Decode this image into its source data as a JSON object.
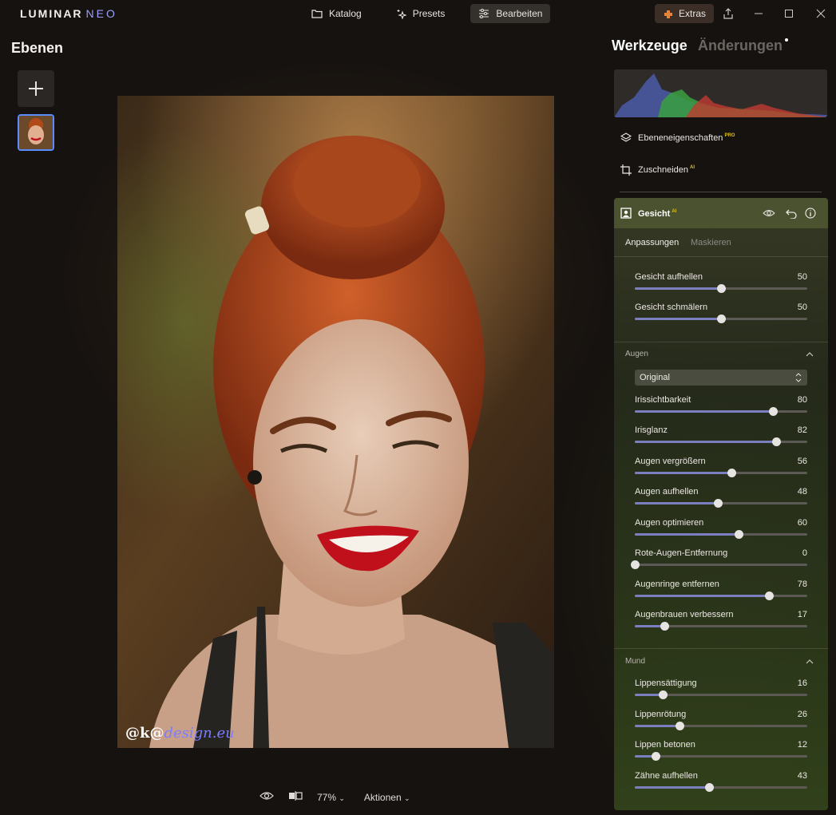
{
  "app": {
    "logo_main": "LUMINAR",
    "logo_accent": "NEO"
  },
  "topnav": [
    {
      "label": "Katalog",
      "icon": "folder-icon",
      "active": false
    },
    {
      "label": "Presets",
      "icon": "sparkle-icon",
      "active": false
    },
    {
      "label": "Bearbeiten",
      "icon": "sliders-icon",
      "active": true
    }
  ],
  "extras": {
    "label": "Extras"
  },
  "layers": {
    "title": "Ebenen"
  },
  "right_tabs": {
    "tools": "Werkzeuge",
    "history": "Änderungen"
  },
  "tools": {
    "layer_props": {
      "label": "Ebeneneigenschaften",
      "badge": "PRO"
    },
    "crop": {
      "label": "Zuschneiden",
      "badge": "AI"
    }
  },
  "face_tool": {
    "title": "Gesicht",
    "badge": "AI",
    "subtabs": [
      "Anpassungen",
      "Maskieren"
    ],
    "general": [
      {
        "label": "Gesicht aufhellen",
        "value": 50
      },
      {
        "label": "Gesicht schmälern",
        "value": 50
      }
    ],
    "eyes": {
      "title": "Augen",
      "select": "Original",
      "sliders": [
        {
          "label": "Irissichtbarkeit",
          "value": 80
        },
        {
          "label": "Irisglanz",
          "value": 82
        },
        {
          "label": "Augen vergrößern",
          "value": 56
        },
        {
          "label": "Augen aufhellen",
          "value": 48
        },
        {
          "label": "Augen optimieren",
          "value": 60
        },
        {
          "label": "Rote-Augen-Entfernung",
          "value": 0
        },
        {
          "label": "Augenringe entfernen",
          "value": 78
        },
        {
          "label": "Augenbrauen verbessern",
          "value": 17
        }
      ]
    },
    "mouth": {
      "title": "Mund",
      "sliders": [
        {
          "label": "Lippensättigung",
          "value": 16
        },
        {
          "label": "Lippenrötung",
          "value": 26
        },
        {
          "label": "Lippen betonen",
          "value": 12
        },
        {
          "label": "Zähne aufhellen",
          "value": 43
        }
      ]
    }
  },
  "bottom": {
    "zoom": "77%",
    "actions": "Aktionen"
  },
  "watermark": {
    "part1": "@k@",
    "part2": "design.eu"
  },
  "colors": {
    "accent": "#7b7fbf",
    "active_border": "#5a8cff",
    "badge": "#d8c020"
  }
}
